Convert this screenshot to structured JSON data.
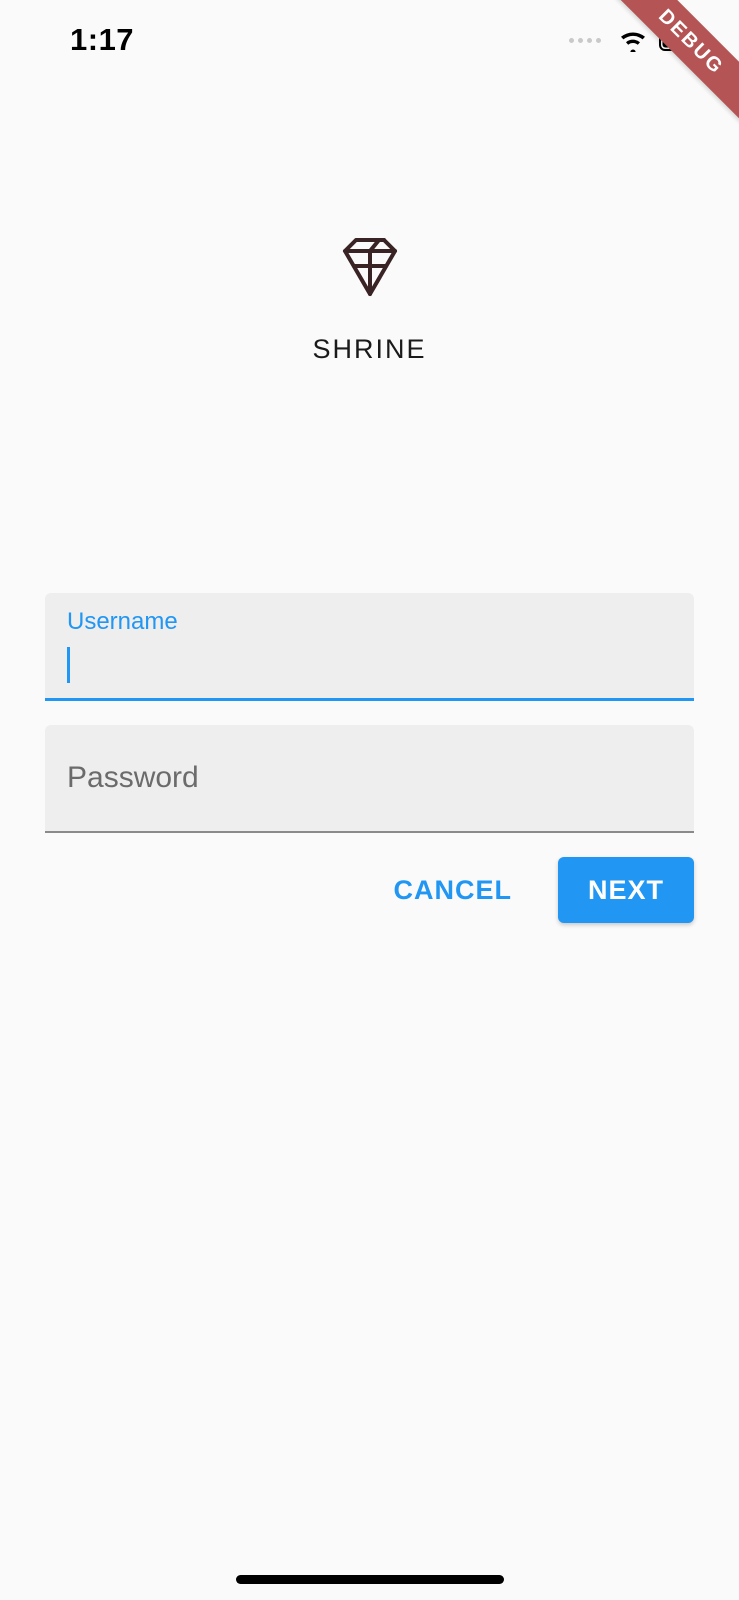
{
  "status_bar": {
    "time": "1:17"
  },
  "debug_banner": {
    "label": "DEBUG"
  },
  "logo": {
    "app_name": "SHRINE"
  },
  "form": {
    "username": {
      "label": "Username",
      "value": ""
    },
    "password": {
      "label": "Password",
      "value": ""
    }
  },
  "buttons": {
    "cancel": "CANCEL",
    "next": "NEXT"
  },
  "colors": {
    "accent": "#2196f3",
    "field_bg": "#eeeeee",
    "debug_banner": "#b45454",
    "logo_stroke": "#3a2324"
  }
}
